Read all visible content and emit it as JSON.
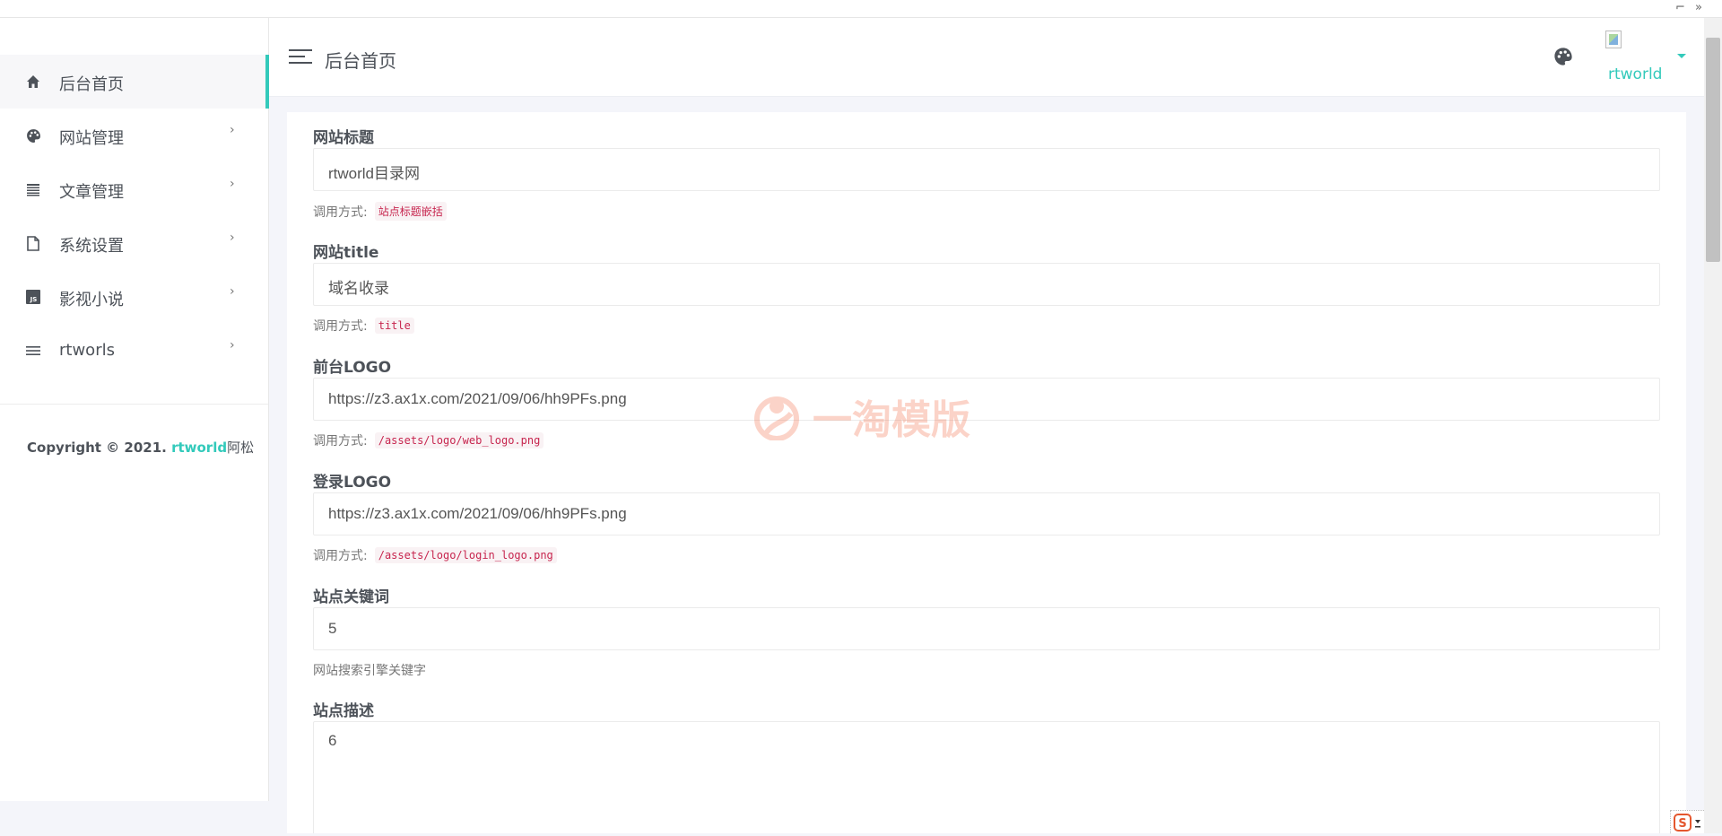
{
  "topbar": {
    "ctrl_left": "⁣⌐",
    "ctrl_right": "»"
  },
  "sidebar": {
    "items": [
      {
        "label": "后台首页",
        "icon": "home-icon",
        "active": true
      },
      {
        "label": "网站管理",
        "icon": "palette-icon"
      },
      {
        "label": "文章管理",
        "icon": "list-icon"
      },
      {
        "label": "系统设置",
        "icon": "file-icon"
      },
      {
        "label": "影视小说",
        "icon": "js-icon"
      },
      {
        "label": "rtworls",
        "icon": "menu-icon"
      }
    ],
    "copyright_prefix": "Copyright © 2021. ",
    "copyright_brand": "rtworld",
    "copyright_suffix": "阿松"
  },
  "header": {
    "title": "后台首页",
    "username": "rtworld"
  },
  "form": {
    "site_title": {
      "label": "网站标题",
      "value": "rtworld目录网",
      "help_prefix": "调用方式:",
      "help_code": "站点标题嵌括"
    },
    "site_title_en": {
      "label": "网站title",
      "value": "域名收录",
      "help_prefix": "调用方式:",
      "help_code": "title"
    },
    "front_logo": {
      "label": "前台LOGO",
      "value": "https://z3.ax1x.com/2021/09/06/hh9PFs.png",
      "help_prefix": "调用方式:",
      "help_code": "/assets/logo/web_logo.png"
    },
    "login_logo": {
      "label": "登录LOGO",
      "value": "https://z3.ax1x.com/2021/09/06/hh9PFs.png",
      "help_prefix": "调用方式:",
      "help_code": "/assets/logo/login_logo.png"
    },
    "keywords": {
      "label": "站点关键词",
      "value": "5",
      "help": "网站搜索引擎关键字"
    },
    "description": {
      "label": "站点描述",
      "value": "6"
    }
  },
  "watermark": {
    "text": "一淘模版"
  },
  "colors": {
    "accent": "#33cabb",
    "code_fg": "#c7254e",
    "code_bg": "#f9f2f4"
  }
}
